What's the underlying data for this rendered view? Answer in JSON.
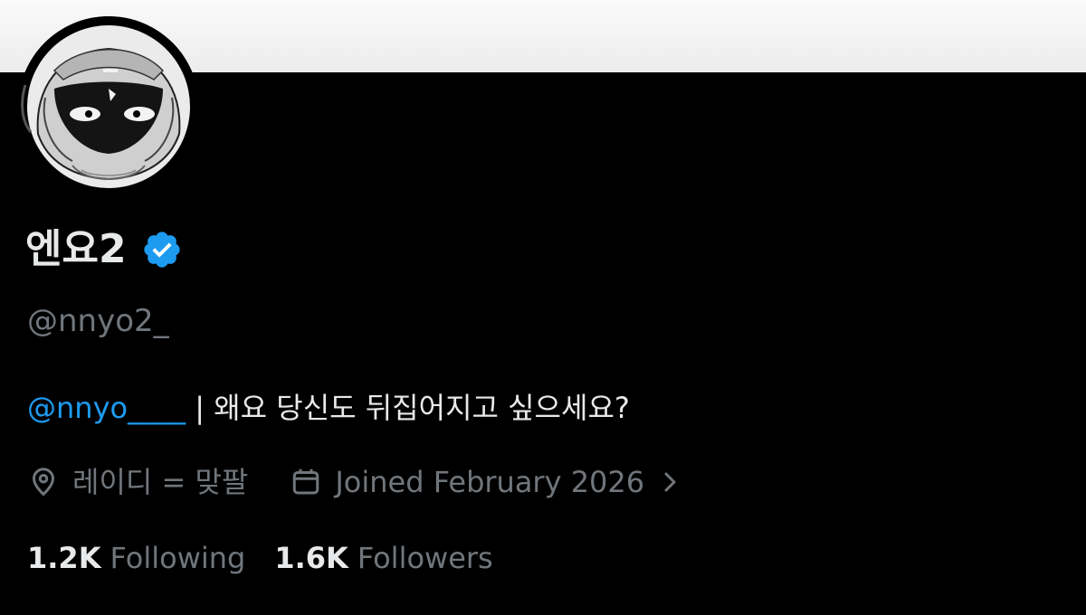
{
  "profile": {
    "display_name": "엔요2",
    "verified": true,
    "verified_icon": "verified-badge-icon",
    "handle": "@nnyo2_",
    "bio": {
      "mention": "@nnyo____",
      "text": " | 왜요 당신도 뒤집어지고 싶으세요?"
    },
    "location": "레이디 = 맞팔",
    "location_icon": "location-pin-icon",
    "joined": "Joined February 2026",
    "joined_icon": "calendar-icon",
    "stats": {
      "following_count": "1.2K",
      "following_label": "Following",
      "followers_count": "1.6K",
      "followers_label": "Followers"
    }
  },
  "colors": {
    "background": "#000000",
    "text_primary": "#e7e9ea",
    "text_secondary": "#71767b",
    "accent": "#1d9bf0",
    "banner": "#f2f2f2"
  }
}
